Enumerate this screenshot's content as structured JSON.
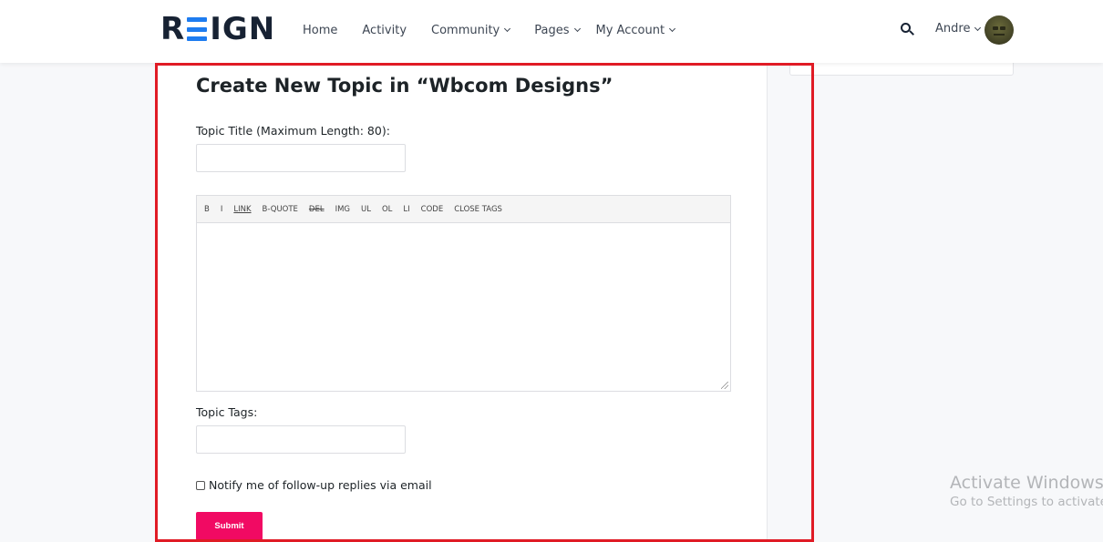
{
  "header": {
    "logo_left": "R",
    "logo_right": "IGN",
    "nav": [
      {
        "label": "Home"
      },
      {
        "label": "Activity"
      },
      {
        "label": "Community"
      },
      {
        "label": "Pages"
      },
      {
        "label": "My Account"
      }
    ],
    "user_name": "Andre"
  },
  "form": {
    "title": "Create New Topic in “Wbcom Designs”",
    "topic_title_label": "Topic Title (Maximum Length: 80):",
    "topic_title_value": "",
    "toolbar": [
      "B",
      "I",
      "LINK",
      "B-QUOTE",
      "DEL",
      "IMG",
      "UL",
      "OL",
      "LI",
      "CODE",
      "CLOSE TAGS"
    ],
    "content_value": "",
    "tags_label": "Topic Tags:",
    "tags_value": "",
    "notify_label": "Notify me of follow-up replies via email",
    "notify_checked": false,
    "submit_label": "Submit"
  },
  "watermark": {
    "line1": "Activate Windows",
    "line2": "Go to Settings to activate"
  },
  "colors": {
    "accent": "#f10a63",
    "logo_dark": "#172233",
    "logo_blue": "#1e7cf0",
    "highlight": "#e01b25"
  }
}
